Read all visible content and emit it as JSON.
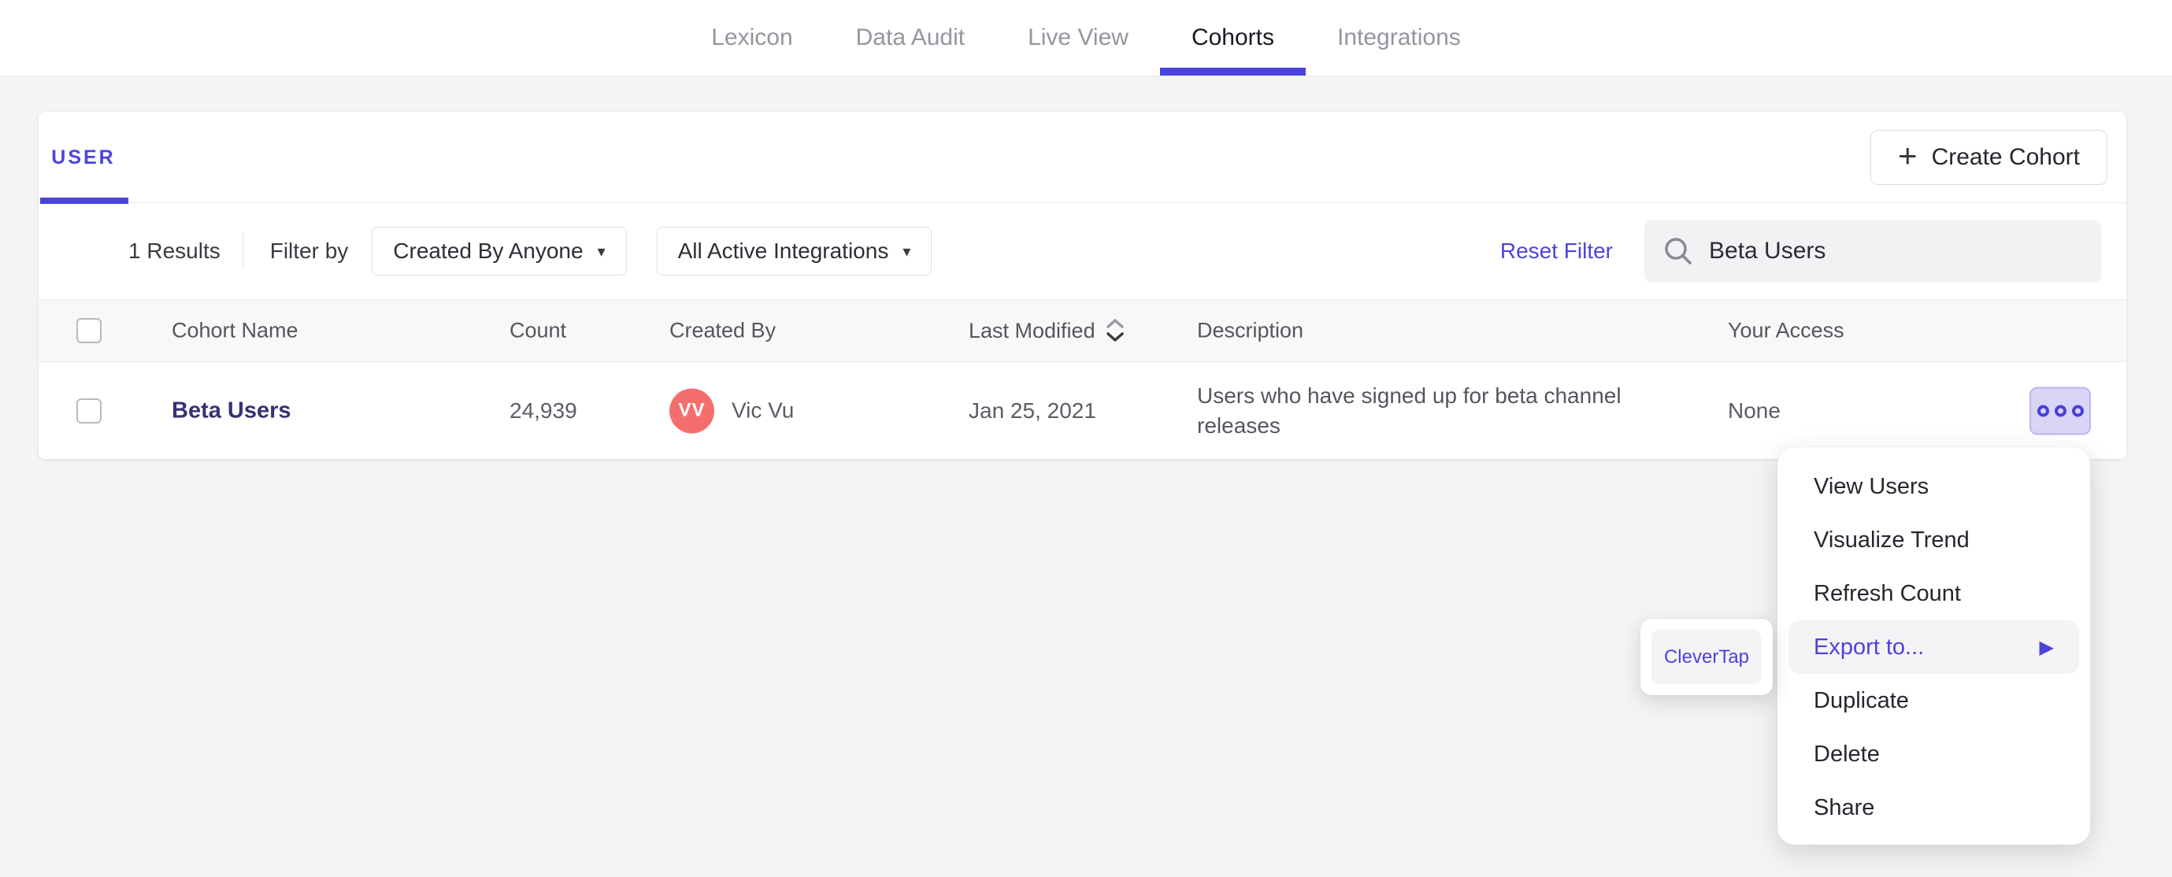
{
  "nav": {
    "tabs": [
      {
        "label": "Lexicon"
      },
      {
        "label": "Data Audit"
      },
      {
        "label": "Live View"
      },
      {
        "label": "Cohorts"
      },
      {
        "label": "Integrations"
      }
    ],
    "active_tab": "Cohorts"
  },
  "cohort_panel": {
    "type_tab": "USER",
    "create_button": "Create Cohort",
    "results_count": "1 Results",
    "filter_by_label": "Filter by",
    "created_by_filter": "Created By Anyone",
    "integrations_filter": "All Active Integrations",
    "reset_filter": "Reset Filter",
    "search": {
      "value": "Beta Users"
    }
  },
  "table": {
    "headers": {
      "name": "Cohort Name",
      "count": "Count",
      "created_by": "Created By",
      "last_modified": "Last Modified",
      "description": "Description",
      "access": "Your Access"
    },
    "rows": [
      {
        "name": "Beta Users",
        "count": "24,939",
        "avatar_initials": "VV",
        "created_by": "Vic Vu",
        "last_modified": "Jan 25, 2021",
        "description": "Users who have signed up for beta channel releases",
        "access": "None"
      }
    ]
  },
  "context_menu": {
    "items": [
      "View Users",
      "Visualize Trend",
      "Refresh Count",
      "Export to...",
      "Duplicate",
      "Delete",
      "Share"
    ],
    "highlighted_item": "Export to..."
  },
  "export_submenu": {
    "items": [
      {
        "label": "CleverTap"
      }
    ]
  },
  "icons": {
    "plus": "+",
    "dropdown_caret": "▾",
    "submenu_arrow": "▶",
    "search": "magnifier",
    "sort": "up-down-chevrons",
    "actions": "three-circles"
  },
  "colors": {
    "accent": "#4C43DD",
    "cohort_link": "#343176",
    "avatar": "#F56E6E",
    "actions_button_bg": "#D8D5F6",
    "page_background": "#F4F4F5"
  }
}
